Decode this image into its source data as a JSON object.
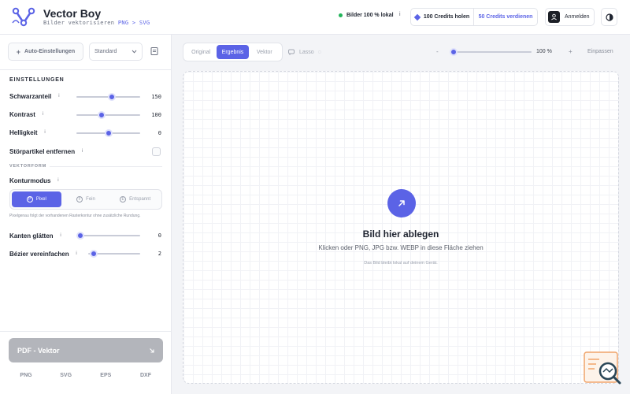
{
  "app": {
    "title": "Vector Boy",
    "subtitle_prefix": "Bilder vektorisieren ",
    "subtitle_formats": "PNG > SVG"
  },
  "header": {
    "status_label": "Bilder 100 % lokal",
    "status_info": "i",
    "credits_get_label": "100 Credits holen",
    "credits_earn_label": "50 Credits verdienen",
    "login_label": "Anmelden"
  },
  "sidebar": {
    "auto_settings_label": "Auto-Einstellungen",
    "preset_value": "Standard",
    "settings_title": "EINSTELLUNGEN",
    "black_share": {
      "label": "Schwarzanteil",
      "value": "150",
      "level": 0.55
    },
    "contrast": {
      "label": "Kontrast",
      "value": "100",
      "level": 0.4
    },
    "brightness": {
      "label": "Helligkeit",
      "value": "0",
      "level": 0.5
    },
    "remove_specks_label": "Störpartikel entfernen",
    "vector_form_title": "VEKTORFORM",
    "contour_mode_label": "Konturmodus",
    "modes": [
      {
        "label": "Pixel",
        "icon": "P",
        "active": true
      },
      {
        "label": "Fein",
        "icon": "F",
        "active": false
      },
      {
        "label": "Entspannt",
        "icon": "E",
        "active": false
      }
    ],
    "mode_hint": "Pixelgenau folgt der vorhandenen Rasterkontur ohne zusätzliche Rundung.",
    "smooth_edges": {
      "label": "Kanten glätten",
      "value": "0",
      "level": 0.0
    },
    "bezier_simplify": {
      "label": "Bézier vereinfachen",
      "value": "2",
      "level": 0.1
    },
    "export_label": "PDF - Vektor",
    "formats": [
      "PNG",
      "SVG",
      "EPS",
      "DXF"
    ]
  },
  "toolbar": {
    "view_tabs": [
      {
        "label": "Original",
        "active": false
      },
      {
        "label": "Ergebnis",
        "active": true
      },
      {
        "label": "Vektor",
        "active": false
      }
    ],
    "lasso_label": "Lasso",
    "zoom_minus": "-",
    "zoom_level": 0.05,
    "zoom_value": "100 %",
    "zoom_plus": "+",
    "fit_label": "Einpassen"
  },
  "dropzone": {
    "title": "Bild hier ablegen",
    "subtitle": "Klicken oder PNG, JPG bzw. WEBP in diese Fläche ziehen",
    "note": "Das Bild bleibt lokal auf deinem Gerät."
  },
  "colors": {
    "accent": "#5b63e6",
    "status_green": "#22b45a",
    "export_disabled": "#b3b5bb",
    "help_orange": "#f0a46b"
  }
}
